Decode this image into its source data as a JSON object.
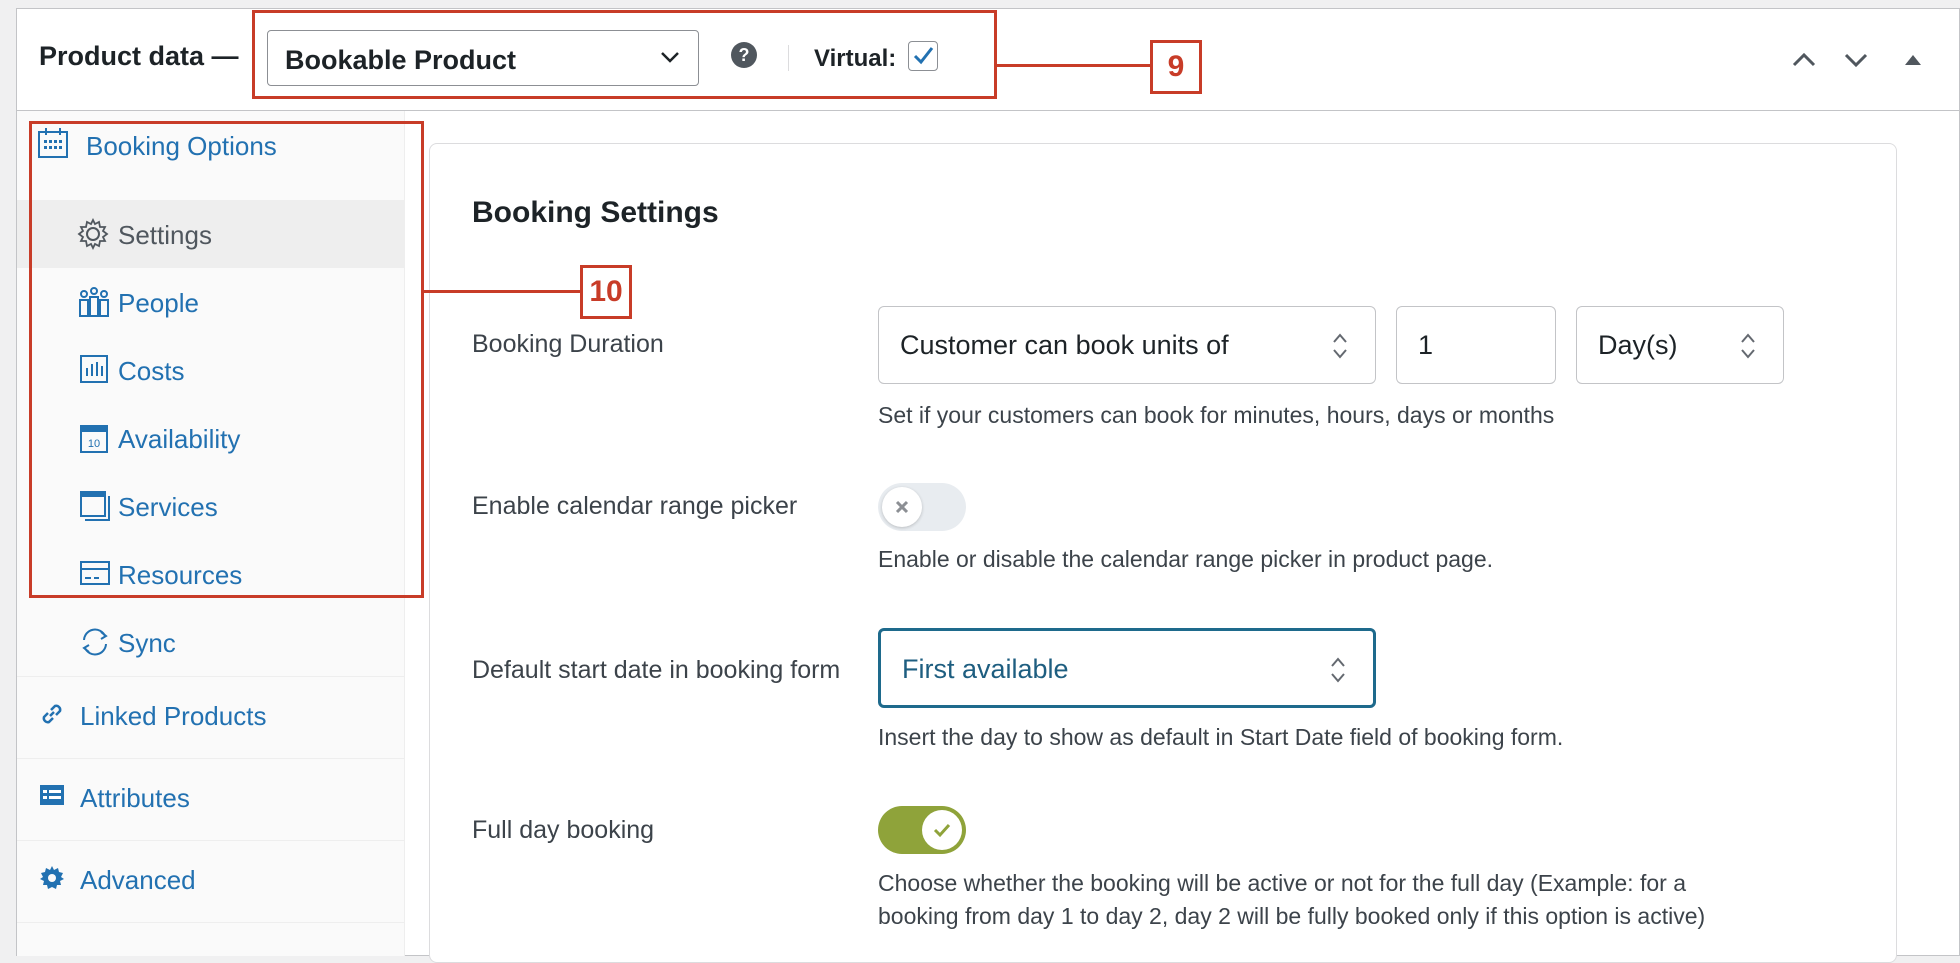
{
  "header": {
    "title": "Product data —",
    "product_type": "Bookable Product",
    "help_icon": "?",
    "virtual_label": "Virtual:",
    "virtual_checked": true
  },
  "sidebar": {
    "booking_options": "Booking Options",
    "sub_items": [
      {
        "label": "Settings",
        "icon": "gear-icon",
        "active": true
      },
      {
        "label": "People",
        "icon": "people-icon"
      },
      {
        "label": "Costs",
        "icon": "chart-icon"
      },
      {
        "label": "Availability",
        "icon": "calendar-icon"
      },
      {
        "label": "Services",
        "icon": "window-icon"
      },
      {
        "label": "Resources",
        "icon": "card-icon"
      },
      {
        "label": "Sync",
        "icon": "sync-icon"
      }
    ],
    "linked_products": "Linked Products",
    "attributes": "Attributes",
    "advanced": "Advanced"
  },
  "content": {
    "section_title": "Booking Settings",
    "booking_duration": {
      "label": "Booking Duration",
      "unit_type": "Customer can book units of",
      "quantity": "1",
      "period": "Day(s)",
      "description": "Set if your customers can book for minutes, hours, days or months"
    },
    "calendar_range": {
      "label": "Enable calendar range picker",
      "enabled": false,
      "description": "Enable or disable the calendar range picker in product page."
    },
    "default_start": {
      "label": "Default start date in booking form",
      "value": "First available",
      "description": "Insert the day to show as default in Start Date field of booking form."
    },
    "full_day": {
      "label": "Full day booking",
      "enabled": true,
      "description_line1": "Choose whether the booking will be active or not for the full day (Example: for a",
      "description_line2": "booking from day 1 to day 2, day 2 will be fully booked only if this option is active)"
    }
  },
  "annotations": {
    "callout_9": "9",
    "callout_10": "10"
  },
  "colors": {
    "link": "#2271b1",
    "toggle_on": "#8fa33a",
    "annotation": "#c83c28"
  }
}
